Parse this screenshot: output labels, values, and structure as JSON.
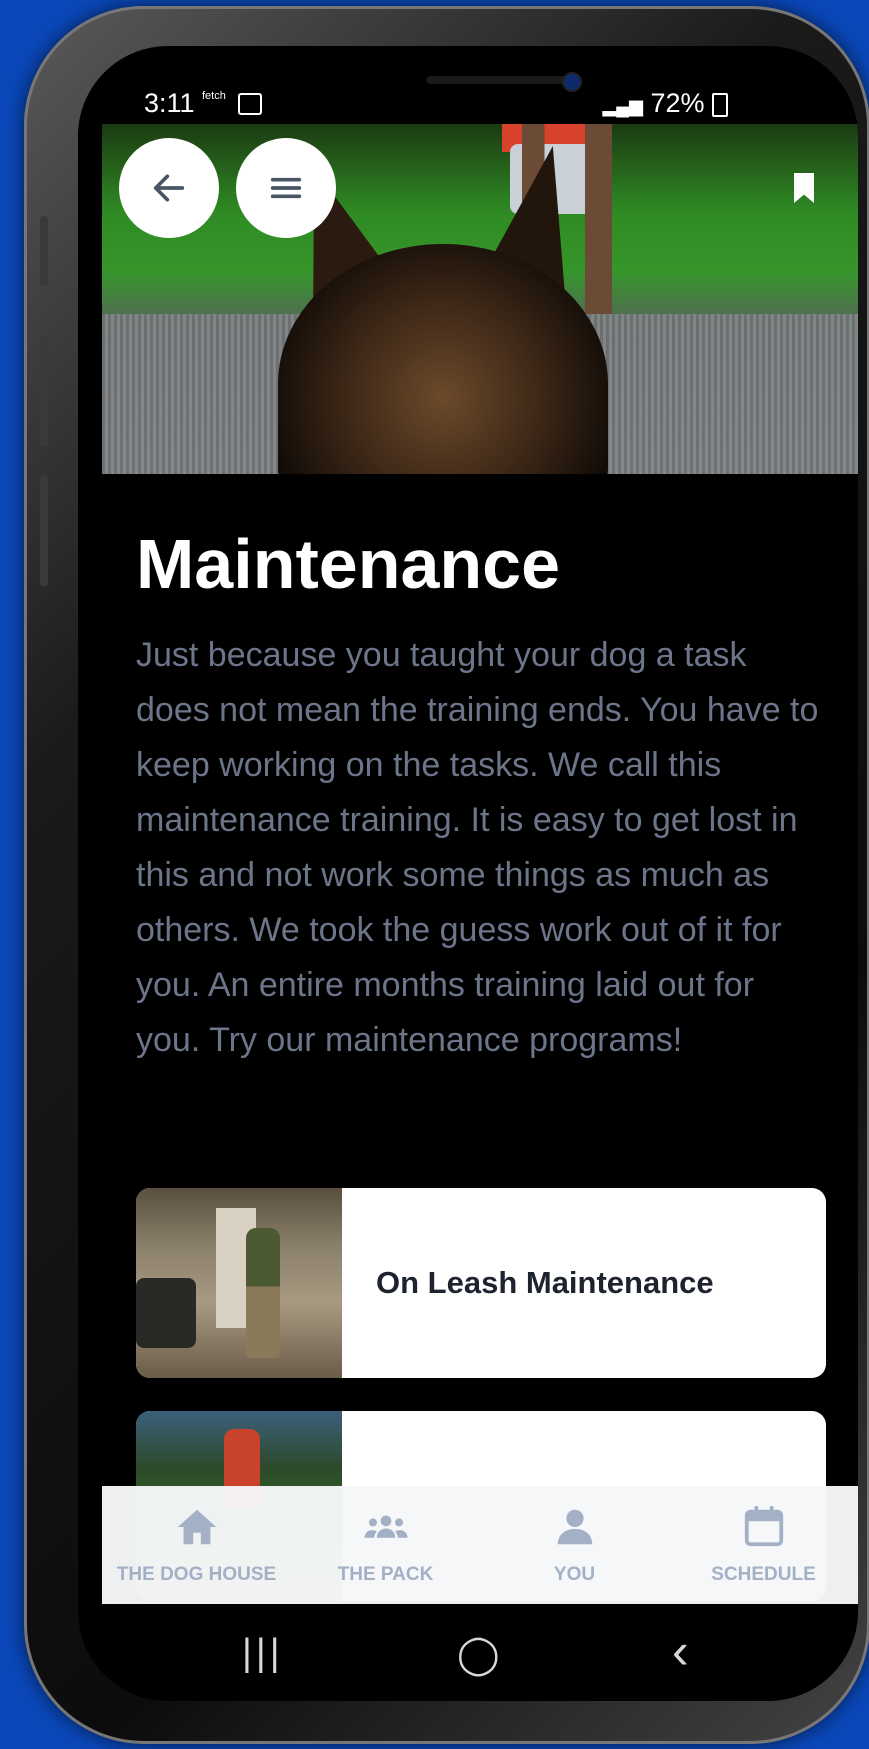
{
  "status_bar": {
    "time": "3:11",
    "left_icons": "fetch",
    "battery": "72%"
  },
  "page": {
    "title": "Maintenance",
    "description": "Just because you taught your dog a task does not mean the training ends. You have to keep working on the tasks. We call this maintenance training. It is easy to get lost in this and not work some things as much as others. We took the guess work out of it for you. An entire months training laid out for you. Try our maintenance programs!"
  },
  "programs": [
    {
      "label": "On Leash Maintenance"
    },
    {
      "label": ""
    }
  ],
  "bottom_nav": {
    "items": [
      {
        "label": "THE DOG HOUSE",
        "icon": "home-icon"
      },
      {
        "label": "THE PACK",
        "icon": "group-icon"
      },
      {
        "label": "YOU",
        "icon": "user-icon"
      },
      {
        "label": "SCHEDULE",
        "icon": "calendar-icon"
      }
    ]
  },
  "system_nav": {
    "recents": "|||",
    "home": "◯",
    "back": "‹"
  },
  "colors": {
    "background": "#0a47b8",
    "nav_label": "#a3b0c6",
    "description": "#6c7589"
  }
}
